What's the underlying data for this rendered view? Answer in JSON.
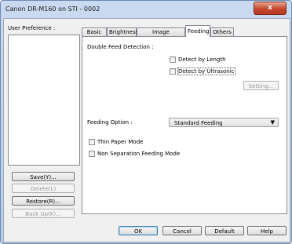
{
  "window": {
    "title": "Canon DR-M160 on STI - 0002",
    "close_glyph": "x"
  },
  "user_preference": {
    "label": "User Preference :",
    "buttons": {
      "save": "Save(Y)...",
      "delete": "Delete(L)",
      "restore": "Restore(R)...",
      "backup": "Back Up(K)..."
    }
  },
  "tabs": [
    "Basic",
    "Brightness",
    "Image processing",
    "Feeding",
    "Others"
  ],
  "active_tab": "Feeding",
  "feeding": {
    "double_feed_label": "Double Feed Detection :",
    "detect_by_length": {
      "label": "Detect by Length",
      "checked": false
    },
    "detect_by_ultrasonic": {
      "label": "Detect by Ultrasonic",
      "checked": false
    },
    "setting_button": "Setting...",
    "feeding_option_label": "Feeding Option :",
    "feeding_option_value": "Standard Feeding",
    "thin_paper": {
      "label": "Thin Paper Mode",
      "checked": false
    },
    "non_separation": {
      "label": "Non Separation Feeding Mode",
      "checked": false
    }
  },
  "footer": {
    "ok": "OK",
    "cancel": "Cancel",
    "default": "Default",
    "help": "Help"
  },
  "colors": {
    "title_bar": "#c9daf0",
    "close_button": "#c5462c",
    "client_bg": "#f0f0f0"
  }
}
